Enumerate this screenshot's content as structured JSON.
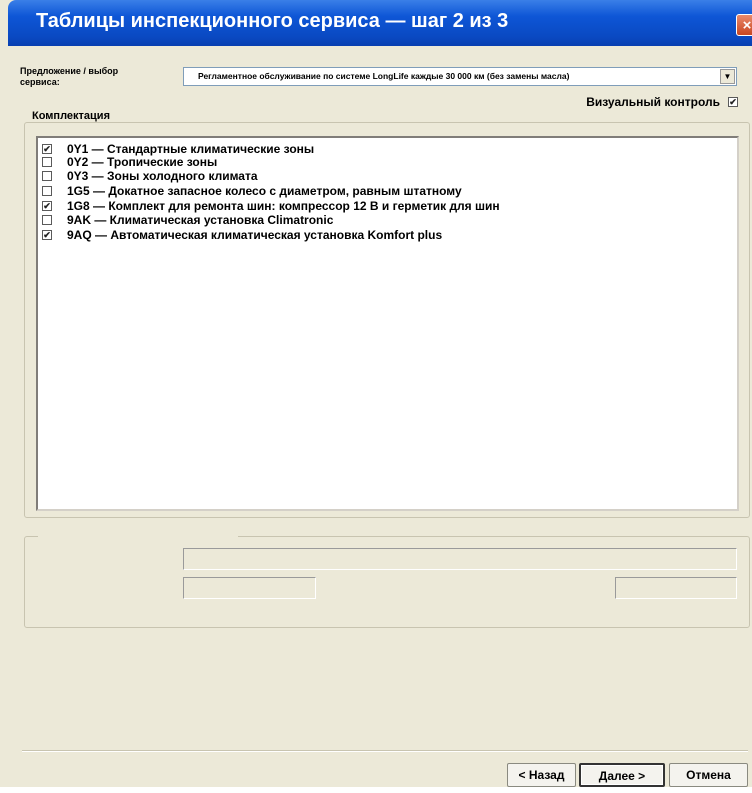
{
  "window": {
    "title": "Таблицы инспекционного сервиса — шаг 2 из 3",
    "close_glyph": "×"
  },
  "offer": {
    "label": "Предложение / выбор сервиса:",
    "selected": "Регламентное обслуживание по системе LongLife каждые 30 000 км (без замены масла)",
    "arrow_glyph": "▼"
  },
  "visual_control": {
    "label": "Визуальный контроль",
    "checked": true
  },
  "equipment": {
    "legend": "Комплектация",
    "items": [
      {
        "text": "0Y1 — Стандартные климатические зоны",
        "checked": true
      },
      {
        "text": "0Y2 — Тропические зоны",
        "checked": false
      },
      {
        "text": "0Y3 — Зоны холодного климата",
        "checked": false
      },
      {
        "text": "1G5 — Докатное запасное колесо с диаметром, равным штатному",
        "checked": false
      },
      {
        "text": "1G8 — Комплект для ремонта шин: компрессор 12 В и герметик для шин",
        "checked": true
      },
      {
        "text": "9AK — Климатическая установка Climatronic",
        "checked": false
      },
      {
        "text": "9AQ — Автоматическая климатическая установка Komfort plus",
        "checked": true
      }
    ]
  },
  "check_glyph": "✔",
  "buttons": {
    "back": "< Назад",
    "next": "Далее >",
    "cancel": "Отмена"
  }
}
